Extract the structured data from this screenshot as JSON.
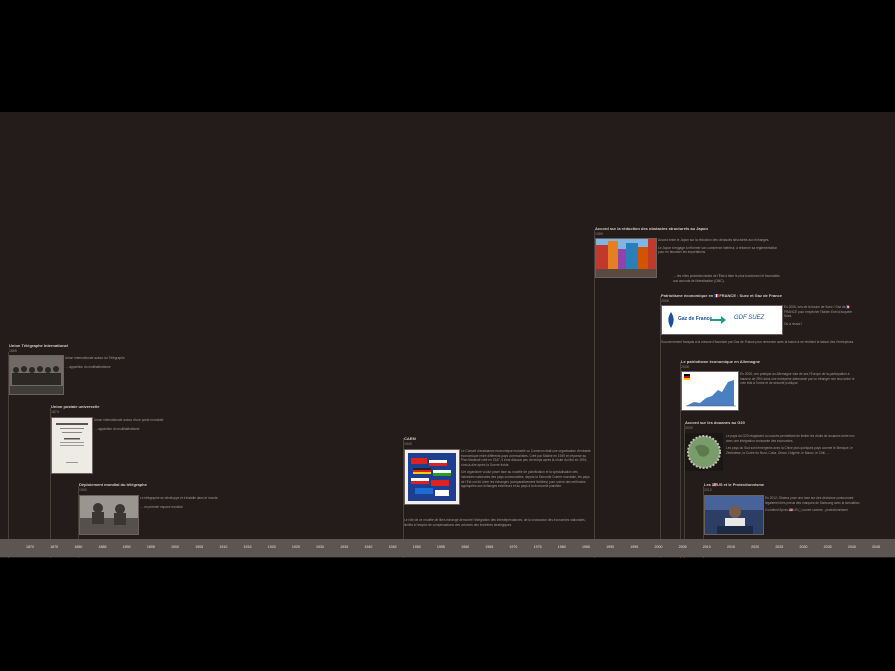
{
  "timeline": {
    "axis_years": [
      "1870",
      "1875",
      "1880",
      "1885",
      "1890",
      "1895",
      "1900",
      "1905",
      "1910",
      "1915",
      "1920",
      "1925",
      "1930",
      "1935",
      "1940",
      "1945",
      "1950",
      "1955",
      "1960",
      "1965",
      "1970",
      "1975",
      "1980",
      "1985",
      "1990",
      "1995",
      "2000",
      "2005",
      "2010",
      "2015",
      "2020",
      "2025",
      "2030",
      "2035",
      "2040",
      "2045"
    ],
    "events": [
      {
        "title": "Union Télégraphe International",
        "date": "1865",
        "text": [
          "Union internationale autour du Télégraphe",
          "→ apparition du multilatéralisme"
        ]
      },
      {
        "title": "Union postale universelle",
        "date": "1874",
        "text": [
          "Union internationale autour d'une poste mondiale",
          "→ apparition du multilatéralisme"
        ]
      },
      {
        "title": "Déploiement mondial du télégraphe",
        "date": "1900",
        "text": [
          "Le télégraphe se développe et s'installe dans le monde.",
          "→ un premier espace mondial"
        ]
      },
      {
        "title": "CAEM",
        "date": "1949",
        "text": [
          "Le Conseil d'assistance économique mutuelle ou Comecon était une organisation d'entraide économique entre différents pays communistes. Créé par Staline en 1949 en réponse au Plan Marshall créé en 1947, il s'est dissous peu de temps après la chute du Mur en 1991, c'est-à-dire après la Guerre froide.",
          "Cet organisme voulut poser face au modèle de planification et la spécialisation des industries nationales des pays communistes, depuis la Seconde Guerre mondiale, les pays de l'Est ont dû créer les échanges (comparativement limitées) pour suivre des méthodes appliquées aux échanges extérieurs et au pays à la économie planifiée.",
          "Le rôle de ce modèle de libre-échange démontre l'intégration des interdépendances, de la croissance des économies nationales, limités à l'emploi de compensations des volumes des frontières stratégiques."
        ]
      },
      {
        "title": "Accord sur la réduction des obstacles structurels au Japon",
        "date": "1989",
        "text": [
          "Accord entre le Japon sur la réduction des obstacles structurels aux échanges.",
          "Le Japon s'engage à réformer son commerce intérieur, à réformer sa réglementation pour en favoriser les importations.",
          "→ les rôles protectionnistes de l'État à faire le plus fonctionnel et favorables aux accords de libéralisation (OMC)."
        ]
      },
      {
        "title": "Patriotisme économique en 🇫🇷FRANCE : Suez et Gaz de France",
        "date": "2006",
        "text": [
          "En 2006, lors de la fusion de Suez / Gaz de 🇫🇷FRANCE pour empêcher l'Italien Enel d'acquérir Suez.",
          "Où a réussi !",
          "Gouvernement français a la mesure d'favoriser par Gaz de France pour renverser avec la fusion à ne révélant la liaison des l'entreprises."
        ]
      },
      {
        "title": "Le patriotisme économique en Allemagne",
        "date": "2008",
        "text": [
          "En 2008, une pratique au Allemagne vise de ses l'Europe de la participation à hauteur de 25% dans une entreprise allemande par un étranger non issu selon le vote état à l'ordre et de sécurité publique."
        ]
      },
      {
        "title": "Accord sur les douanes au G20",
        "date": "2009",
        "text": [
          "Le pays du G20 réagissent au succès permettant de limiter les droits de douanes entre eux avec une intégration croissante des économies.",
          "Les pays du Sud sont émergents avec la Chine plus quelques pays comme le Mexique, le Zimbabwe, la Corée du Nord, Cuba, Oman, l'Algérie, le Maroc, le Chili, ..."
        ]
      },
      {
        "title": "Les 🇺🇸US et le Protectionnisme",
        "date": "2012",
        "text": [
          "En 2012, Obama pose une taxe sur des décisions contournant légalement les pneus des marques de Samsung avec la simulation.",
          "Il contient 5pneu 🇺🇸US ( ) ouvert comme - protectionnisme"
        ]
      }
    ]
  },
  "images": {
    "gaz_logo_left": "Gaz de France",
    "gaz_logo_right": "GDF SUEZ",
    "stamp_label": "COMECON"
  },
  "colors": {
    "background": "#231c1a",
    "axis": "#5d5552",
    "letterbox": "#000000"
  }
}
